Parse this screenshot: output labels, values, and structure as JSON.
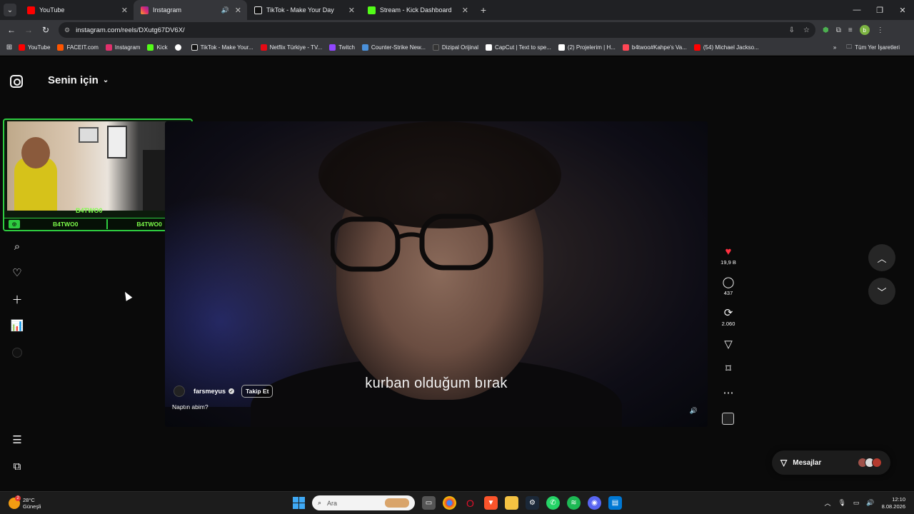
{
  "browser": {
    "tabs": [
      {
        "title": "YouTube",
        "favicon_color": "#ff0000",
        "active": false
      },
      {
        "title": "Instagram",
        "favicon_color": "#e1306c",
        "active": true
      },
      {
        "title": "TikTok - Make Your Day",
        "favicon_color": "#ffffff",
        "active": false
      },
      {
        "title": "Stream - Kick Dashboard",
        "favicon_color": "#53fc18",
        "active": false
      }
    ],
    "url": "instagram.com/reels/DXutg67DV6X/",
    "bookmarks": [
      {
        "label": "YouTube",
        "color": "#ff0000"
      },
      {
        "label": "FACEIT.com",
        "color": "#ff5500"
      },
      {
        "label": "Instagram",
        "color": "#e1306c"
      },
      {
        "label": "Kick",
        "color": "#53fc18"
      },
      {
        "label": "",
        "color": "#ffffff"
      },
      {
        "label": "TikTok - Make Your...",
        "color": "#ffffff"
      },
      {
        "label": "Netflix Türkiye - TV...",
        "color": "#e50914"
      },
      {
        "label": "Twitch",
        "color": "#9146ff"
      },
      {
        "label": "Counter-Strike New...",
        "color": "#4a90d9"
      },
      {
        "label": "Dizipal Orijinal",
        "color": "#333333"
      },
      {
        "label": "CapCut | Text to spe...",
        "color": "#ffffff"
      },
      {
        "label": "(2)  Projelerim | H...",
        "color": "#ffffff"
      },
      {
        "label": "b4twoo#Kahpe's Va...",
        "color": "#ff4655"
      },
      {
        "label": "(54) Michael Jackso...",
        "color": "#ff0000"
      }
    ],
    "all_bookmarks": "Tüm Yer İşaretleri",
    "profile_initial": "b"
  },
  "page": {
    "feed_title": "Senin için",
    "webcam": {
      "tag": "B4TWO0",
      "bar_left": "B4TWO0",
      "bar_right": "B4TWO0"
    },
    "reel": {
      "subtitle": "kurban olduğum bırak",
      "author": "farsmeyus",
      "follow_label": "Takip Et",
      "caption": "Naptın abim?"
    },
    "actions": {
      "likes": "19,9 B",
      "comments": "437",
      "reposts": "2.060"
    },
    "messages_label": "Mesajlar",
    "accent_color": "#ff3040"
  },
  "taskbar": {
    "weather_temp": "28°C",
    "weather_desc": "Güneşli",
    "weather_badge": "2",
    "search_placeholder": "Ara",
    "time": "12:10",
    "date": "8.08.2026"
  }
}
